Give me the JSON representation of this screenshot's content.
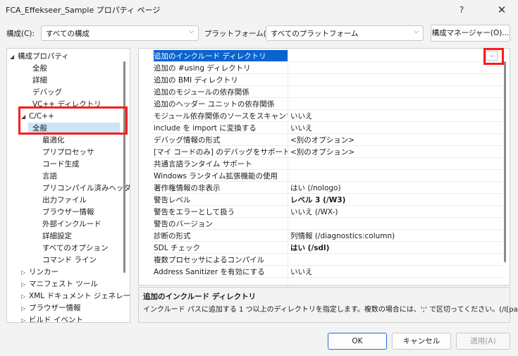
{
  "window": {
    "title": "FCA_Effekseer_Sample プロパティ ページ",
    "help": "?",
    "close": "✕"
  },
  "config": {
    "label": "構成(C):",
    "value": "すべての構成",
    "platform_label": "プラットフォーム(P):",
    "platform_value": "すべてのプラットフォーム",
    "manager_button": "構成マネージャー(O)..."
  },
  "tree": {
    "items": [
      {
        "label": "構成プロパティ",
        "caret": "◢"
      },
      {
        "label": "全般"
      },
      {
        "label": "詳細"
      },
      {
        "label": "デバッグ"
      },
      {
        "label": "VC++ ディレクトリ"
      },
      {
        "label": "C/C++",
        "caret": "◢"
      },
      {
        "label": "全般"
      },
      {
        "label": "最適化"
      },
      {
        "label": "プリプロセッサ"
      },
      {
        "label": "コード生成"
      },
      {
        "label": "言語"
      },
      {
        "label": "プリコンパイル済みヘッダー"
      },
      {
        "label": "出力ファイル"
      },
      {
        "label": "ブラウザー情報"
      },
      {
        "label": "外部インクルード"
      },
      {
        "label": "詳細設定"
      },
      {
        "label": "すべてのオプション"
      },
      {
        "label": "コマンド ライン"
      },
      {
        "label": "リンカー",
        "caret": "▷"
      },
      {
        "label": "マニフェスト ツール",
        "caret": "▷"
      },
      {
        "label": "XML ドキュメント ジェネレータ",
        "caret": "▷"
      },
      {
        "label": "ブラウザー情報",
        "caret": "▷"
      },
      {
        "label": "ビルド イベント",
        "caret": "▷"
      }
    ]
  },
  "grid": {
    "rows": [
      {
        "key": "追加のインクルード ディレクトリ",
        "value": ""
      },
      {
        "key": "追加の #using ディレクトリ",
        "value": ""
      },
      {
        "key": "追加の BMI ディレクトリ",
        "value": ""
      },
      {
        "key": "追加のモジュールの依存関係",
        "value": ""
      },
      {
        "key": "追加のヘッダー ユニットの依存関係",
        "value": ""
      },
      {
        "key": "モジュール依存関係のソースをスキャンする",
        "value": "いいえ"
      },
      {
        "key": "include を import に変換する",
        "value": "いいえ"
      },
      {
        "key": "デバッグ情報の形式",
        "value": "<別のオプション>"
      },
      {
        "key": "[マイ コードのみ] のデバッグをサポートする",
        "value": "<別のオプション>"
      },
      {
        "key": "共通言語ランタイム サポート",
        "value": ""
      },
      {
        "key": "Windows ランタイム拡張機能の使用",
        "value": ""
      },
      {
        "key": "著作権情報の非表示",
        "value": "はい (/nologo)"
      },
      {
        "key": "警告レベル",
        "value": "レベル 3 (/W3)"
      },
      {
        "key": "警告をエラーとして扱う",
        "value": "いいえ (/WX-)"
      },
      {
        "key": "警告のバージョン",
        "value": ""
      },
      {
        "key": "診断の形式",
        "value": "列情報 (/diagnostics:column)"
      },
      {
        "key": "SDL チェック",
        "value": "はい (/sdl)"
      },
      {
        "key": "複数プロセッサによるコンパイル",
        "value": ""
      },
      {
        "key": "Address Sanitizer を有効にする",
        "value": "いいえ"
      },
      {
        "key": "",
        "value": ""
      }
    ]
  },
  "description": {
    "title": "追加のインクルード ディレクトリ",
    "text": "インクルード パスに追加する 1 つ以上のディレクトリを指定します。複数の場合には、';' で区切ってください。(/I[path])"
  },
  "buttons": {
    "ok": "OK",
    "cancel": "キャンセル",
    "apply": "適用(A)"
  },
  "icons": {
    "dropdown": "⌵",
    "combo_arrow": "⌵"
  },
  "colors": {
    "selection": "#0a64d0",
    "tree_selection": "#cce4f7",
    "highlight": "#ff1a1a"
  }
}
